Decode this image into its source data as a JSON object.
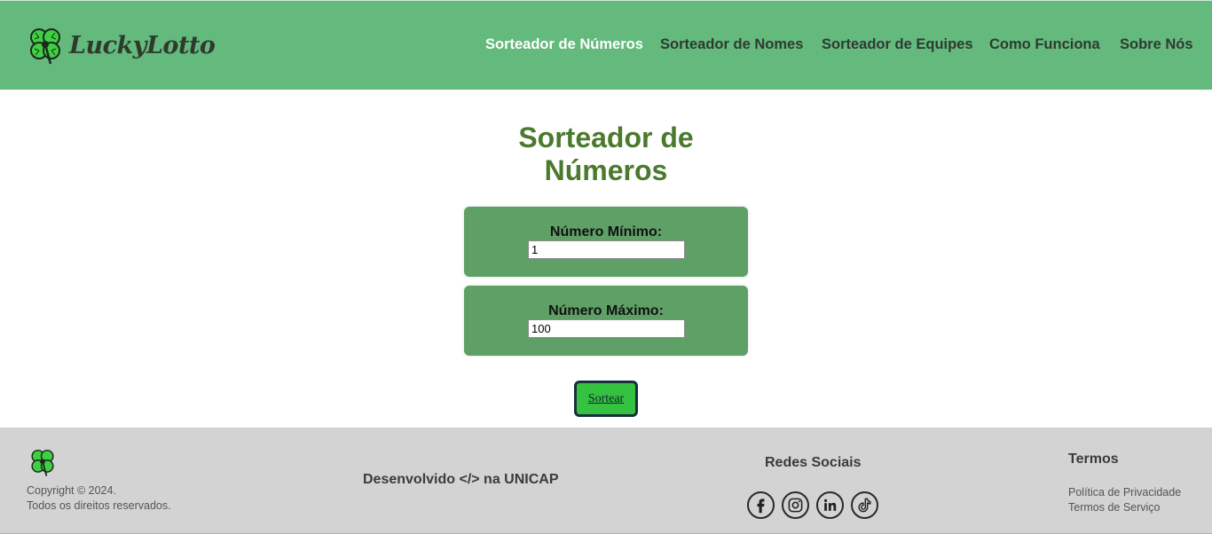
{
  "brand": {
    "name": "LuckyLotto",
    "logo_icon": "clover-icon"
  },
  "nav": {
    "items": [
      {
        "label": "Sorteador de Números",
        "active": true
      },
      {
        "label": "Sorteador de Nomes",
        "active": false
      },
      {
        "label": "Sorteador de Equipes",
        "active": false
      },
      {
        "label": "Como Funciona",
        "active": false
      },
      {
        "label": "Sobre Nós",
        "active": false
      }
    ]
  },
  "main": {
    "title_line1": "Sorteador de",
    "title_line2": "Números",
    "min": {
      "label": "Número Mínimo:",
      "value": "1"
    },
    "max": {
      "label": "Número Máximo:",
      "value": "100"
    },
    "draw_button": "Sortear"
  },
  "footer": {
    "copyright": "Copyright © 2024.",
    "rights": "Todos os direitos reservados.",
    "developed": "Desenvolvido </> na UNICAP",
    "social_title": "Redes Sociais",
    "social": [
      "facebook-icon",
      "instagram-icon",
      "linkedin-icon",
      "tiktok-icon"
    ],
    "terms_title": "Termos",
    "privacy": "Política de Privacidade",
    "service": "Termos de Serviço"
  },
  "colors": {
    "header_bg": "#64b97c",
    "title": "#4a7a2c",
    "card_bg": "#5fa066",
    "button_bg": "#34c240",
    "footer_bg": "#d3d3d3"
  }
}
